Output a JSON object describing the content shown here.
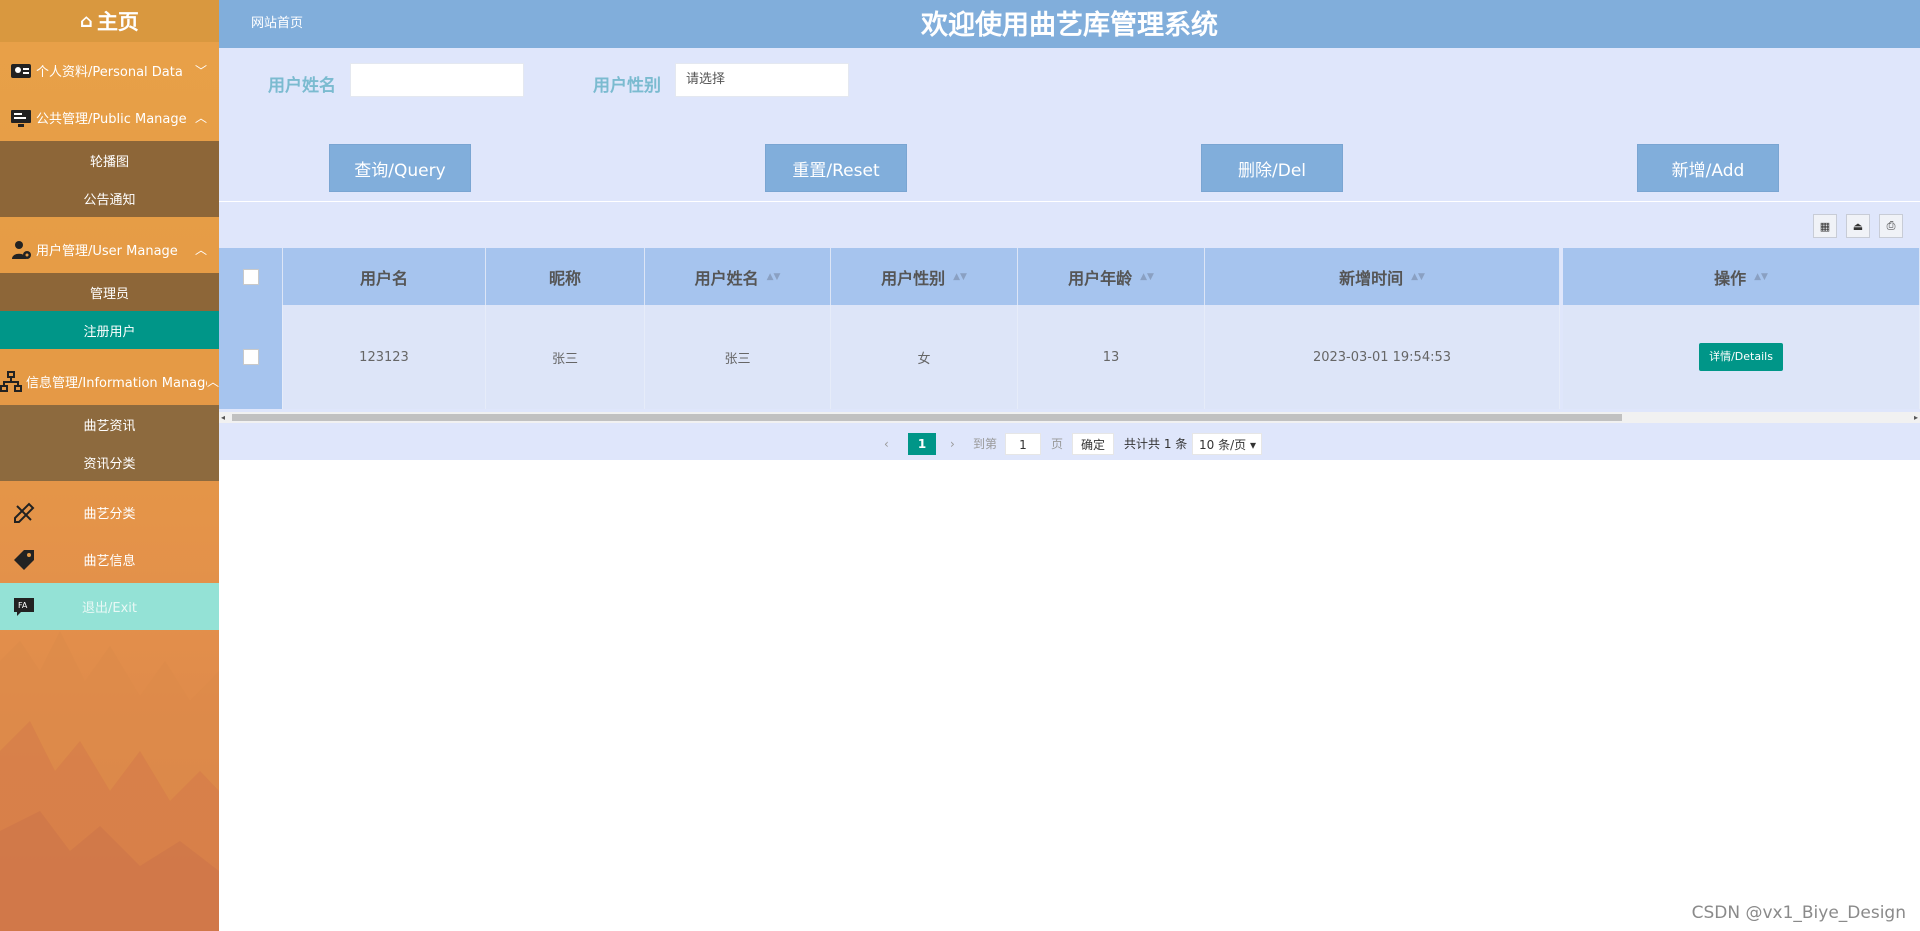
{
  "sidebar": {
    "home": "主页",
    "groups": [
      {
        "label": "个人资料/Personal Data",
        "icon": "person-card-icon",
        "expanded": false
      },
      {
        "label": "公共管理/Public Manage",
        "icon": "monitor-icon",
        "expanded": true,
        "items": [
          "轮播图",
          "公告通知"
        ]
      },
      {
        "label": "用户管理/User Manage",
        "icon": "user-gear-icon",
        "expanded": true,
        "items": [
          "管理员",
          "注册用户"
        ],
        "active_item": "注册用户"
      },
      {
        "label": "信息管理/Information Manage",
        "icon": "network-icon",
        "expanded": true,
        "items": [
          "曲艺资讯",
          "资讯分类"
        ]
      }
    ],
    "items": [
      {
        "label": "曲艺分类",
        "icon": "pencil-ruler-icon"
      },
      {
        "label": "曲艺信息",
        "icon": "price-tag-icon"
      },
      {
        "label": "退出/Exit",
        "icon": "exit-chat-icon"
      }
    ]
  },
  "header": {
    "home_link": "网站首页",
    "title": "欢迎使用曲艺库管理系统"
  },
  "search": {
    "name_label": "用户姓名",
    "name_value": "",
    "gender_label": "用户性别",
    "gender_value": "请选择"
  },
  "buttons": {
    "query": "查询/Query",
    "reset": "重置/Reset",
    "delete": "删除/Del",
    "add": "新增/Add"
  },
  "toolbar": {
    "icons": [
      "columns-filter-icon",
      "export-icon",
      "print-icon"
    ]
  },
  "table": {
    "headers": [
      "用户名",
      "昵称",
      "用户姓名",
      "用户性别",
      "用户年龄",
      "新增时间",
      "操作"
    ],
    "rows": [
      {
        "username": "123123",
        "nickname": "张三",
        "realname": "张三",
        "gender": "女",
        "age": "13",
        "created": "2023-03-01 19:54:53",
        "action": "详情/Details"
      }
    ]
  },
  "pagination": {
    "current": "1",
    "goto_prefix": "到第",
    "goto_value": "1",
    "goto_suffix": "页",
    "confirm": "确定",
    "total": "共计共 1 条",
    "page_size": "10 条/页"
  },
  "watermark": "CSDN @vx1_Biye_Design",
  "colors": {
    "sidebar": "#e59a45",
    "topbar": "#81aedb",
    "content": "#dfe6fb",
    "accent": "#009688",
    "exit": "#94e2d6"
  }
}
